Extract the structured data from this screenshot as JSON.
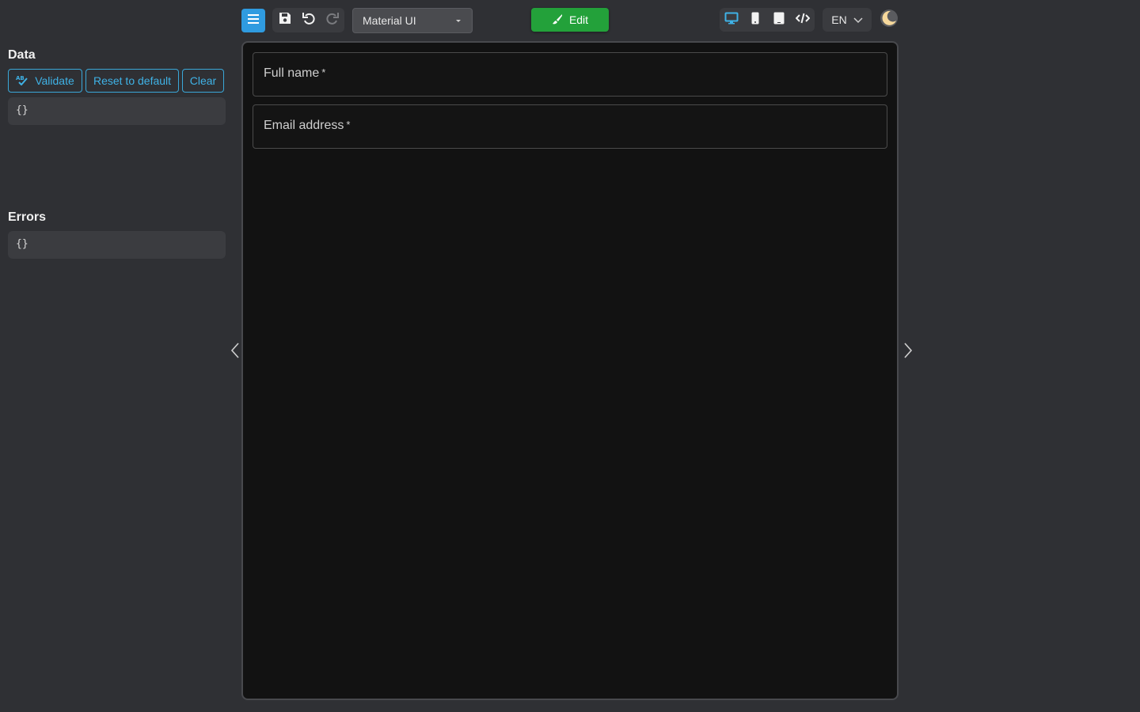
{
  "left_panel": {
    "data_title": "Data",
    "buttons": {
      "validate": "Validate",
      "reset": "Reset to default",
      "clear": "Clear"
    },
    "data_value": "{}",
    "errors_title": "Errors",
    "errors_value": "{}"
  },
  "toolbar": {
    "menu_icon": "menu-icon",
    "save_icon": "save-icon",
    "undo_icon": "undo-icon",
    "redo_icon": "redo-icon",
    "theme_select": "Material UI",
    "edit_label": "Edit",
    "devices": [
      "desktop-icon",
      "phone-icon",
      "tablet-icon",
      "code-icon"
    ],
    "language": "EN",
    "theme_toggle_icon": "moon-icon"
  },
  "form": {
    "fields": [
      {
        "label": "Full name",
        "required": "*"
      },
      {
        "label": "Email address",
        "required": "*"
      }
    ]
  },
  "colors": {
    "accent": "#3fb2e6",
    "edit_green": "#23a13a",
    "menu_blue": "#2f9be0",
    "background": "#2f3034",
    "canvas": "#121212"
  }
}
